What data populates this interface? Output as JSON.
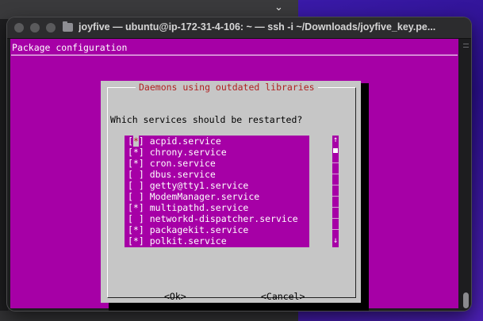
{
  "window": {
    "title": "joyfive — ubuntu@ip-172-31-4-106: ~ — ssh -i ~/Downloads/joyfive_key.pe..."
  },
  "terminal": {
    "header": "Package configuration"
  },
  "dialog": {
    "title": "Daemons using outdated libraries",
    "question": "Which services should be restarted?",
    "items": [
      {
        "mark": "[*]",
        "name": "acpid.service",
        "checked": true
      },
      {
        "mark": "[*]",
        "name": "chrony.service",
        "checked": true
      },
      {
        "mark": "[*]",
        "name": "cron.service",
        "checked": true
      },
      {
        "mark": "[ ]",
        "name": "dbus.service",
        "checked": false
      },
      {
        "mark": "[ ]",
        "name": "getty@tty1.service",
        "checked": false
      },
      {
        "mark": "[ ]",
        "name": "ModemManager.service",
        "checked": false
      },
      {
        "mark": "[*]",
        "name": "multipathd.service",
        "checked": true
      },
      {
        "mark": "[ ]",
        "name": "networkd-dispatcher.service",
        "checked": false
      },
      {
        "mark": "[*]",
        "name": "packagekit.service",
        "checked": true
      },
      {
        "mark": "[*]",
        "name": "polkit.service",
        "checked": true
      }
    ],
    "ok_label": "<Ok>",
    "cancel_label": "<Cancel>",
    "scroll_up_glyph": "↑",
    "scroll_down_glyph": "↓"
  },
  "colors": {
    "terminal_bg": "#a600a6",
    "dialog_bg": "#c6c6c6",
    "title_red": "#b02222"
  }
}
